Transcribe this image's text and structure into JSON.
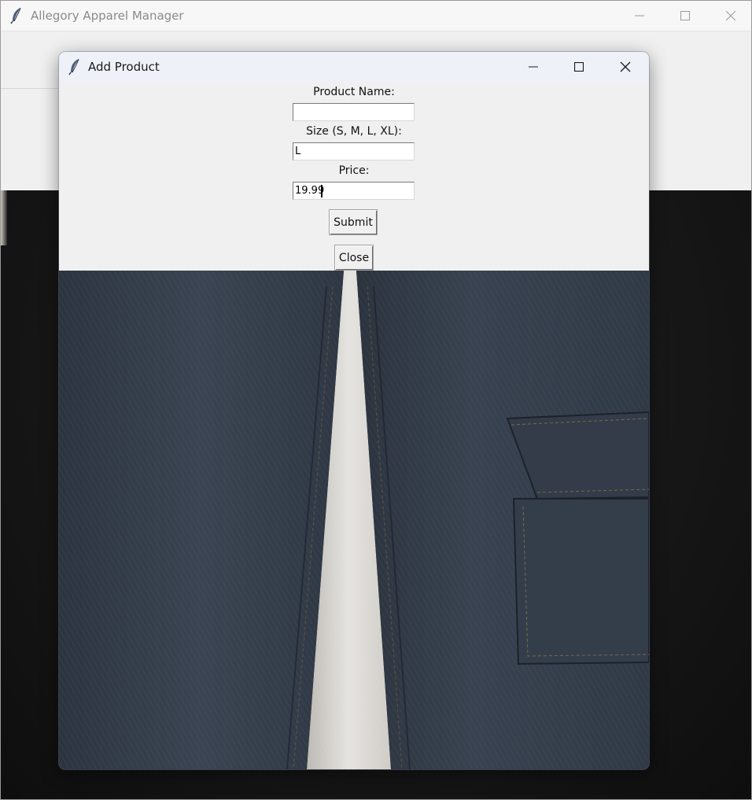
{
  "main_window": {
    "title": "Allegory Apparel Manager",
    "icon": "feather-icon"
  },
  "dialog": {
    "title": "Add Product",
    "icon": "feather-icon",
    "fields": {
      "product_name": {
        "label": "Product Name:",
        "value": ""
      },
      "size": {
        "label": "Size (S, M, L, XL):",
        "value": "L"
      },
      "price": {
        "label": "Price:",
        "value": "19.99"
      }
    },
    "submit_label": "Submit",
    "close_label": "Close",
    "background_image": "denim-jeans-photo"
  },
  "colors": {
    "titlebar_bg": "#f7f7f7",
    "dialog_titlebar_bg": "#eef1f8",
    "form_bg": "#f0f0f0",
    "denim": "#323c48"
  }
}
